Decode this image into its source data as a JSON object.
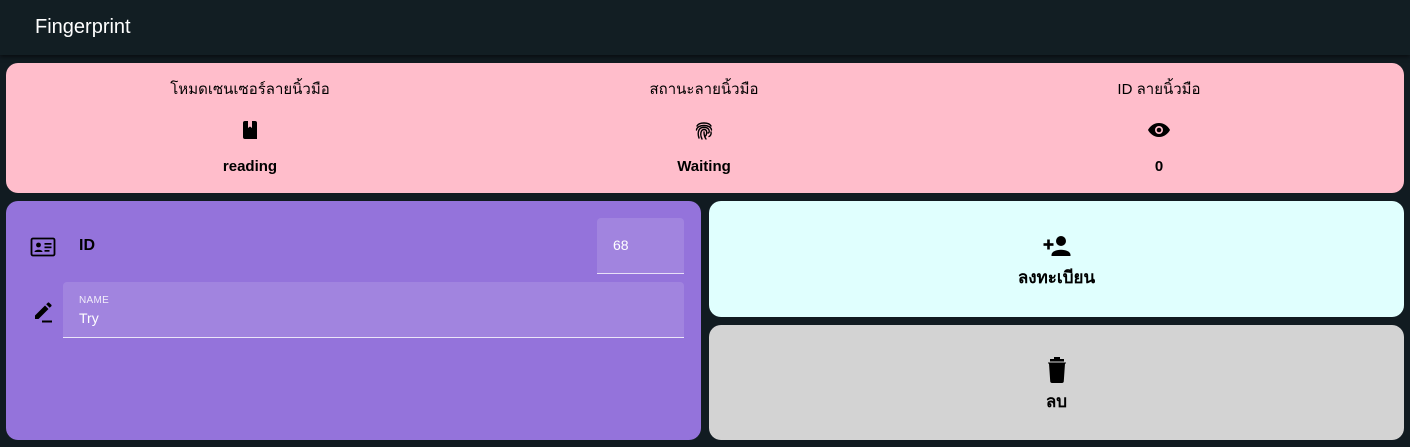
{
  "app": {
    "title": "Fingerprint"
  },
  "status": {
    "items": [
      {
        "label": "โหมดเซนเซอร์ลายนิ้วมือ",
        "icon": "bookmark-icon",
        "value": "reading"
      },
      {
        "label": "สถานะลายนิ้วมือ",
        "icon": "fingerprint-icon",
        "value": "Waiting"
      },
      {
        "label": "ID ลายนิ้วมือ",
        "icon": "eye-icon",
        "value": "0"
      }
    ]
  },
  "form": {
    "id_label": "ID",
    "id_value": "68",
    "id_icon": "id-card-icon",
    "edit_icon": "edit-icon",
    "name_label": "NAME",
    "name_value": "Try"
  },
  "actions": {
    "register": {
      "label": "ลงทะเบียน",
      "icon": "person-add-icon"
    },
    "delete": {
      "label": "ลบ",
      "icon": "trash-icon"
    }
  },
  "colors": {
    "topbar": "#121e23",
    "status_card": "#ffbdcb",
    "form_card": "#9473db",
    "register_button": "#e0fffe",
    "delete_button": "#d3d3d3"
  }
}
